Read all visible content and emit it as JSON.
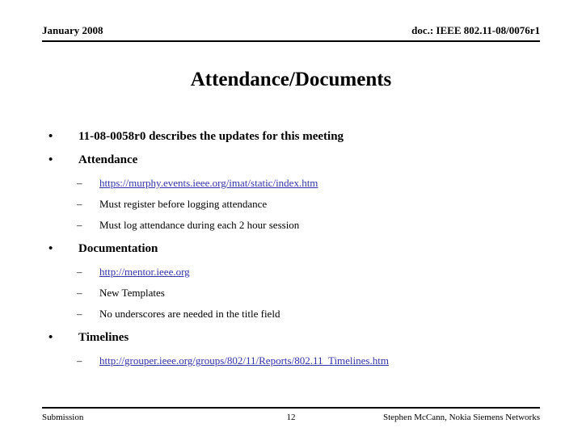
{
  "header": {
    "left": "January 2008",
    "right": "doc.: IEEE 802.11-08/0076r1"
  },
  "title": "Attendance/Documents",
  "colors": {
    "link": "#3333AA",
    "text": "#000000",
    "background": "#ffffff"
  },
  "markers": {
    "level1": "•",
    "level2": "–"
  },
  "bullets": [
    {
      "text": "11-08-0058r0 describes the updates for this meeting",
      "sub": []
    },
    {
      "text": "Attendance",
      "sub": [
        {
          "text": "https://murphy.events.ieee.org/imat/static/index.htm",
          "link": true
        },
        {
          "text": "Must register before logging attendance",
          "link": false
        },
        {
          "text": "Must log attendance during each 2 hour session",
          "link": false
        }
      ]
    },
    {
      "text": "Documentation",
      "sub": [
        {
          "text": "http://mentor.ieee.org",
          "link": true
        },
        {
          "text": "New Templates",
          "link": false
        },
        {
          "text": "No underscores are needed in the title field",
          "link": false
        }
      ]
    },
    {
      "text": "Timelines",
      "sub": [
        {
          "text": "http://grouper.ieee.org/groups/802/11/Reports/802.11_Timelines.htm",
          "link": true
        }
      ]
    }
  ],
  "footer": {
    "left": "Submission",
    "center": "12",
    "right": "Stephen McCann, Nokia Siemens Networks"
  }
}
